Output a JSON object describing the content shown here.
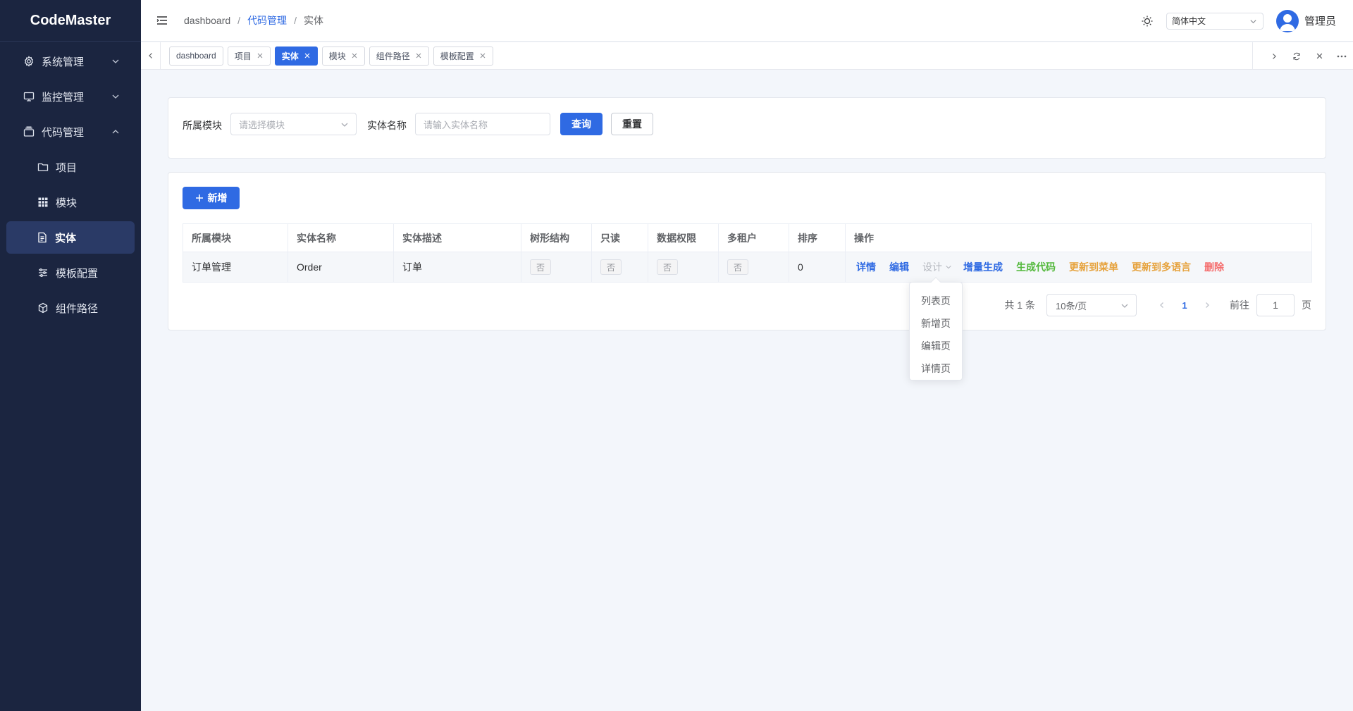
{
  "app": {
    "title": "CodeMaster"
  },
  "sidebar": {
    "groups": [
      {
        "label": "系统管理",
        "icon": "gear-icon"
      },
      {
        "label": "监控管理",
        "icon": "monitor-icon"
      },
      {
        "label": "代码管理",
        "icon": "stack-icon"
      }
    ],
    "items": [
      {
        "label": "项目",
        "icon": "folder-icon"
      },
      {
        "label": "模块",
        "icon": "grid-icon"
      },
      {
        "label": "实体",
        "icon": "document-icon"
      },
      {
        "label": "模板配置",
        "icon": "sliders-icon"
      },
      {
        "label": "组件路径",
        "icon": "cube-icon"
      }
    ],
    "active_item": "实体"
  },
  "header": {
    "breadcrumb": [
      "dashboard",
      "代码管理",
      "实体"
    ],
    "language": "简体中文",
    "user": "管理员"
  },
  "tabs": [
    {
      "label": "dashboard",
      "closable": false
    },
    {
      "label": "项目",
      "closable": true
    },
    {
      "label": "实体",
      "closable": true,
      "active": true
    },
    {
      "label": "模块",
      "closable": true
    },
    {
      "label": "组件路径",
      "closable": true
    },
    {
      "label": "模板配置",
      "closable": true
    }
  ],
  "search": {
    "module_label": "所属模块",
    "module_placeholder": "请选择模块",
    "name_label": "实体名称",
    "name_placeholder": "请输入实体名称",
    "query_button": "查询",
    "reset_button": "重置"
  },
  "table": {
    "add_button": "新增",
    "columns": [
      "所属模块",
      "实体名称",
      "实体描述",
      "树形结构",
      "只读",
      "数据权限",
      "多租户",
      "排序",
      "操作"
    ],
    "rows": [
      {
        "module": "订单管理",
        "name": "Order",
        "description": "订单",
        "tree": "否",
        "readonly": "否",
        "data_permission": "否",
        "multi_tenant": "否",
        "sort": "0"
      }
    ],
    "actions": {
      "detail": "详情",
      "edit": "编辑",
      "design": "设计",
      "incremental": "增量生成",
      "generate": "生成代码",
      "update_menu": "更新到菜单",
      "update_i18n": "更新到多语言",
      "delete": "删除"
    },
    "colors": {
      "primary": "#2f6ae3",
      "success": "#52b83a",
      "warning": "#e6a23c",
      "danger": "#f56c6c"
    }
  },
  "pagination": {
    "total": "共 1 条",
    "page_size": "10条/页",
    "current_page": "1",
    "goto_label": "前往",
    "goto_value": "1",
    "page_suffix": "页"
  },
  "design_dropdown": [
    "列表页",
    "新增页",
    "编辑页",
    "详情页"
  ]
}
